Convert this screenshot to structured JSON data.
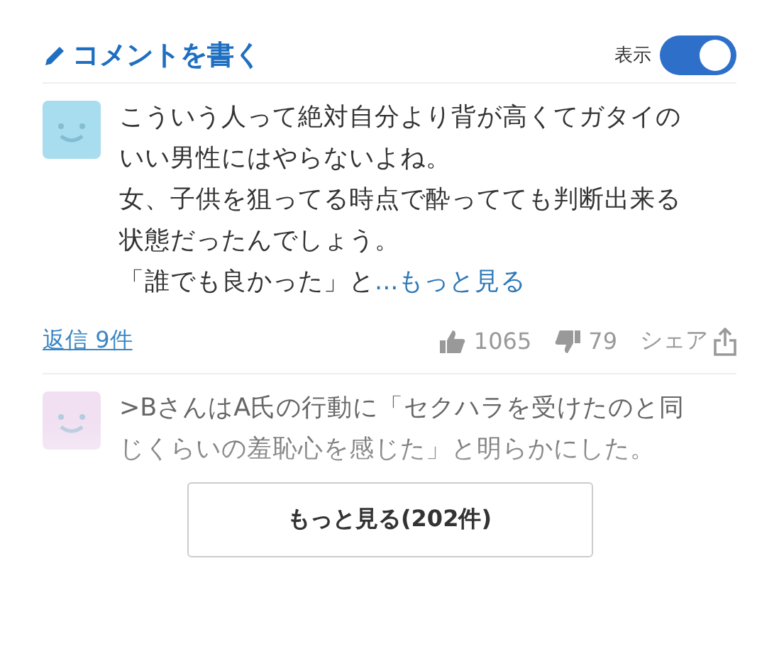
{
  "header": {
    "write_comment": "コメントを書く",
    "display_label": "表示",
    "display_on": true
  },
  "comments": [
    {
      "kind": "full",
      "lines": [
        "こういう人って絶対自分より背が高くてガタイの",
        "いい男性にはやらないよね。",
        "女、子供を狙ってる時点で酔ってても判断出来る",
        "状態だったんでしょう。",
        "「誰でも良かった」と"
      ],
      "more_link": "...もっと見る",
      "replies": "返信 9件",
      "likes": "1065",
      "dislikes": "79",
      "share": "シェア",
      "color": "#a8dcef"
    },
    {
      "kind": "preview",
      "lines": [
        ">BさんはA氏の行動に「セクハラを受けたのと同",
        "じくらいの羞恥心を感じた」と明らかにした。"
      ],
      "color": "#ecd6ee"
    }
  ],
  "more_button": "もっと見る(202件)"
}
